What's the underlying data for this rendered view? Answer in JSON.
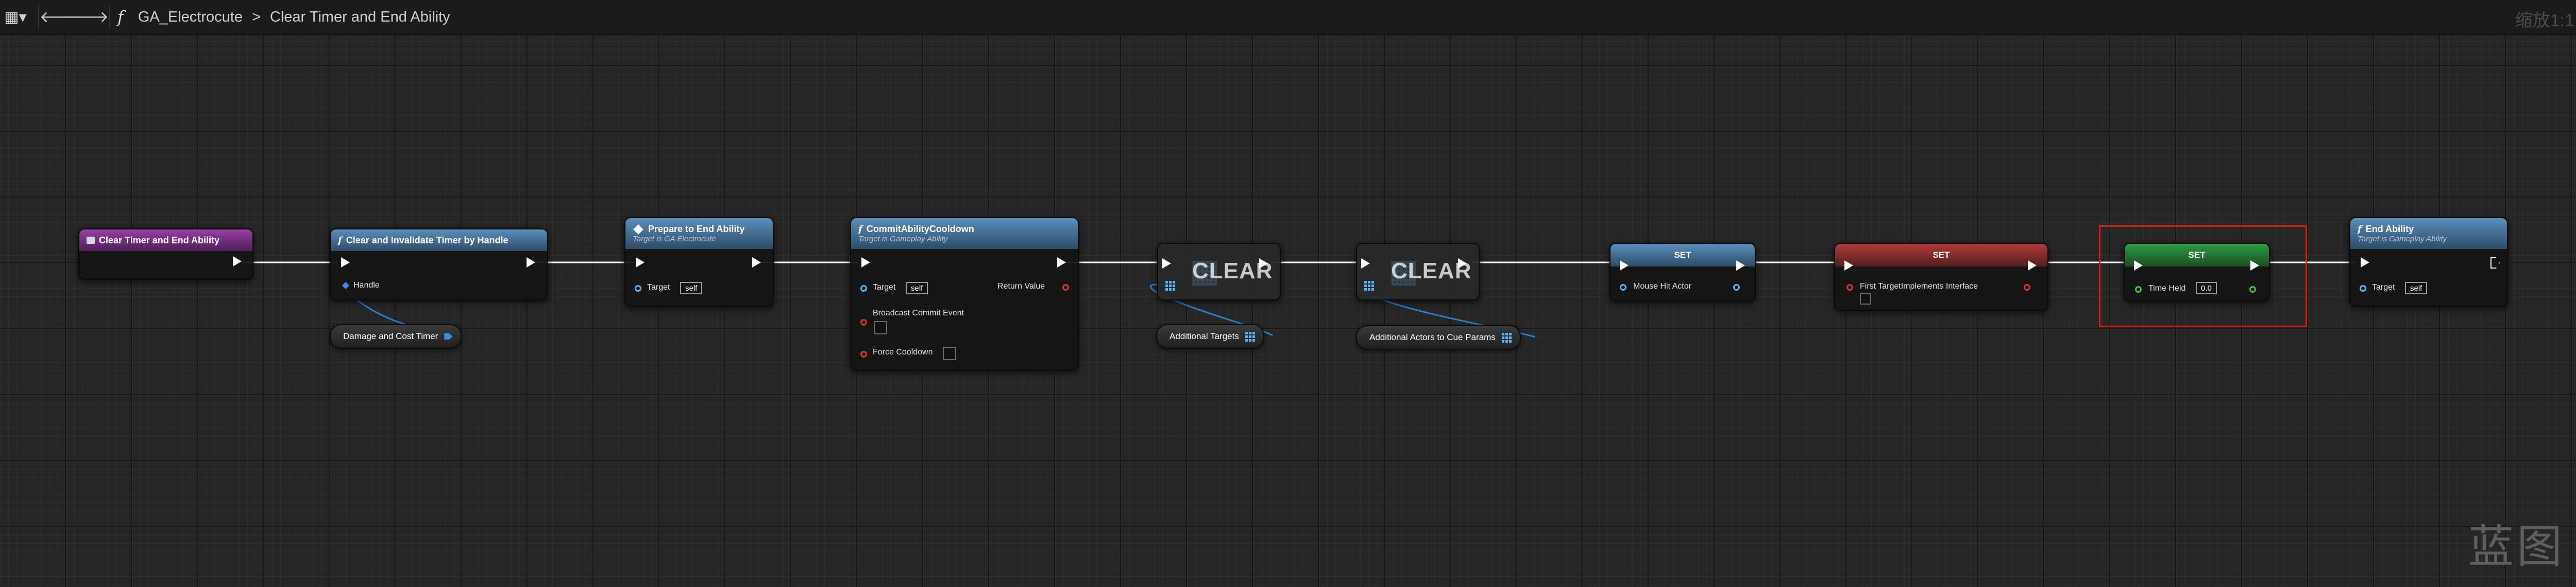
{
  "toolbar": {
    "function_name": "GA_Electrocute",
    "separator": ">",
    "graph_name": "Clear Timer and End Ability",
    "zoom": "缩放1:1"
  },
  "watermark": "蓝图",
  "nodes": {
    "entry": {
      "title": "Clear Timer and End Ability"
    },
    "clear_timer": {
      "title": "Clear and Invalidate Timer by Handle",
      "handle_label": "Handle"
    },
    "prepare": {
      "title": "Prepare to End Ability",
      "subtitle": "Target is GA Electrocute",
      "target_label": "Target",
      "target_value": "self"
    },
    "commit": {
      "title": "CommitAbilityCooldown",
      "subtitle": "Target is Gameplay Ability",
      "target_label": "Target",
      "target_value": "self",
      "return_label": "Return Value",
      "broadcast_label": "Broadcast Commit Event",
      "force_label": "Force Cooldown"
    },
    "clear1": {
      "label": "CLEAR"
    },
    "clear2": {
      "label": "CLEAR"
    },
    "set_mouse": {
      "title": "SET",
      "pin_label": "Mouse Hit Actor"
    },
    "set_first": {
      "title": "SET",
      "pin_label": "First TargetImplements Interface"
    },
    "set_time": {
      "title": "SET",
      "pin_label": "Time Held",
      "value": "0.0"
    },
    "end": {
      "title": "End Ability",
      "subtitle": "Target is Gameplay Ability",
      "target_label": "Target",
      "target_value": "self"
    }
  },
  "variables": {
    "damage_timer": "Damage and Cost Timer",
    "additional_targets": "Additional Targets",
    "cue_params": "Additional Actors to Cue Params"
  },
  "colors": {
    "exec_wire": "#ffffff",
    "object_wire": "#29a8ff",
    "struct_wire": "#2a6fb3",
    "highlight": "#e01818",
    "function_header": "#4a7ca8",
    "event_header": "#9a3fa6",
    "bool_set_header": "#b03a3a",
    "float_set_header": "#2f9a42"
  }
}
